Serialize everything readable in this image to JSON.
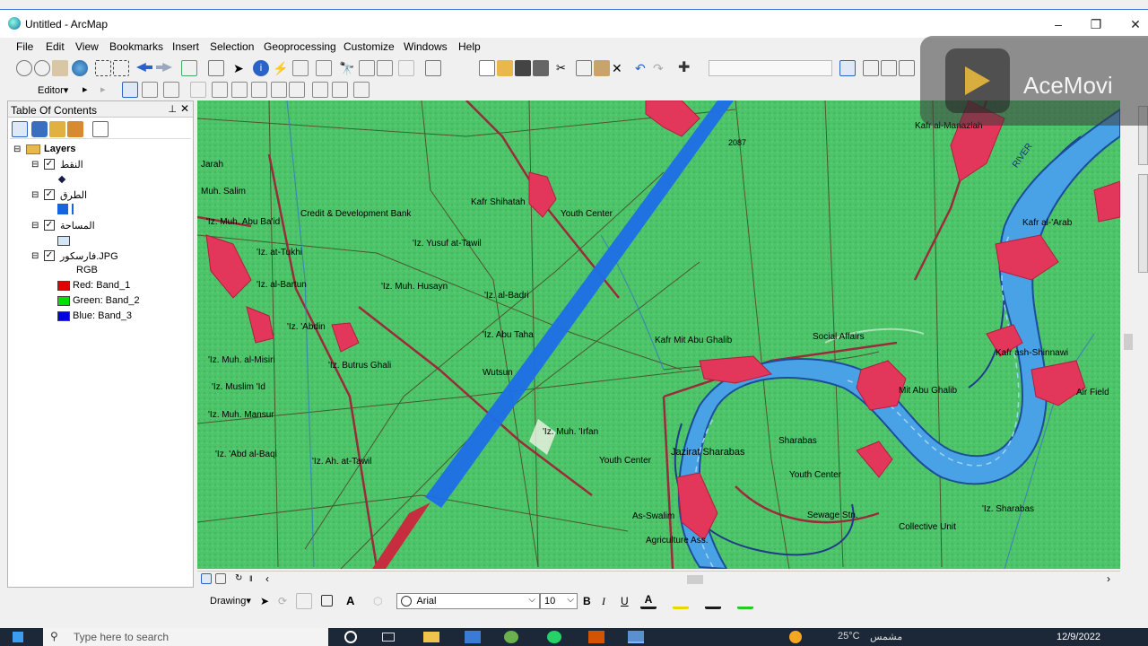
{
  "window": {
    "title": "Untitled - ArcMap"
  },
  "menu": [
    "File",
    "Edit",
    "View",
    "Bookmarks",
    "Insert",
    "Selection",
    "Geoprocessing",
    "Customize",
    "Windows",
    "Help"
  ],
  "editor_toolbar": {
    "editor_label": "Editor▾"
  },
  "toc": {
    "title": "Table Of Contents",
    "root": "Layers",
    "layers": [
      {
        "name": "النقط",
        "checked": true
      },
      {
        "name": "الطرق",
        "checked": true
      },
      {
        "name": "المساحة",
        "checked": true
      },
      {
        "name": "فارسكور.JPG",
        "checked": true
      }
    ],
    "raster_label": "RGB",
    "bands": [
      {
        "label": "Red:   Band_1",
        "color": "#e00000"
      },
      {
        "label": "Green: Band_2",
        "color": "#00e000"
      },
      {
        "label": "Blue:  Band_3",
        "color": "#0000e0"
      }
    ]
  },
  "map_labels": [
    "Kafr Shihatah",
    "Youth Center",
    "'Iz. Yusuf at-Tawil",
    "Credit & Development Bank",
    "'Iz. Muh. Abu Ba'id",
    "'Iz. at-Tukhi",
    "'Iz. al-Bartun",
    "'Iz. Muh. Husayn",
    "'Iz. al-Badri",
    "'Iz. Abu Taha",
    "'Iz. 'Abdin",
    "'Iz. Butrus Ghali",
    "'Iz. Muh. al-Misiri",
    "'Iz. Muslim 'Id",
    "'Iz. Muh. Mansur",
    "'Iz. 'Abd al-Baqi",
    "'Iz. Ah. at-Tawil",
    "Wutsun",
    "'Iz. Muh. 'Irfan",
    "Youth Center",
    "Kafr Mit Abu Ghalib",
    "Social Affairs",
    "Mit Abu Ghalib",
    "Jazirat Sharabas",
    "Sharabas",
    "Youth Center",
    "Sewage Stn.",
    "Collective Unit",
    "'Iz. Sharabas",
    "As-Swalim",
    "Agriculture Ass.",
    "Kafr ash-Shinnawi",
    "Air Field",
    "Kafr al-Manazlah",
    "Kafr al-'Arab",
    "RIVER",
    "2087",
    "Muh. Salim",
    "Jarah"
  ],
  "drawing_toolbar": {
    "drawing_label": "Drawing▾",
    "font": "Arial",
    "size": "10",
    "bold": "B",
    "italic": "I",
    "underline": "U"
  },
  "watermark": "AceMovi",
  "taskbar": {
    "search": "Type here to search",
    "date": "12/9/2022",
    "lang": "مشمس",
    "temp": "25°C"
  }
}
